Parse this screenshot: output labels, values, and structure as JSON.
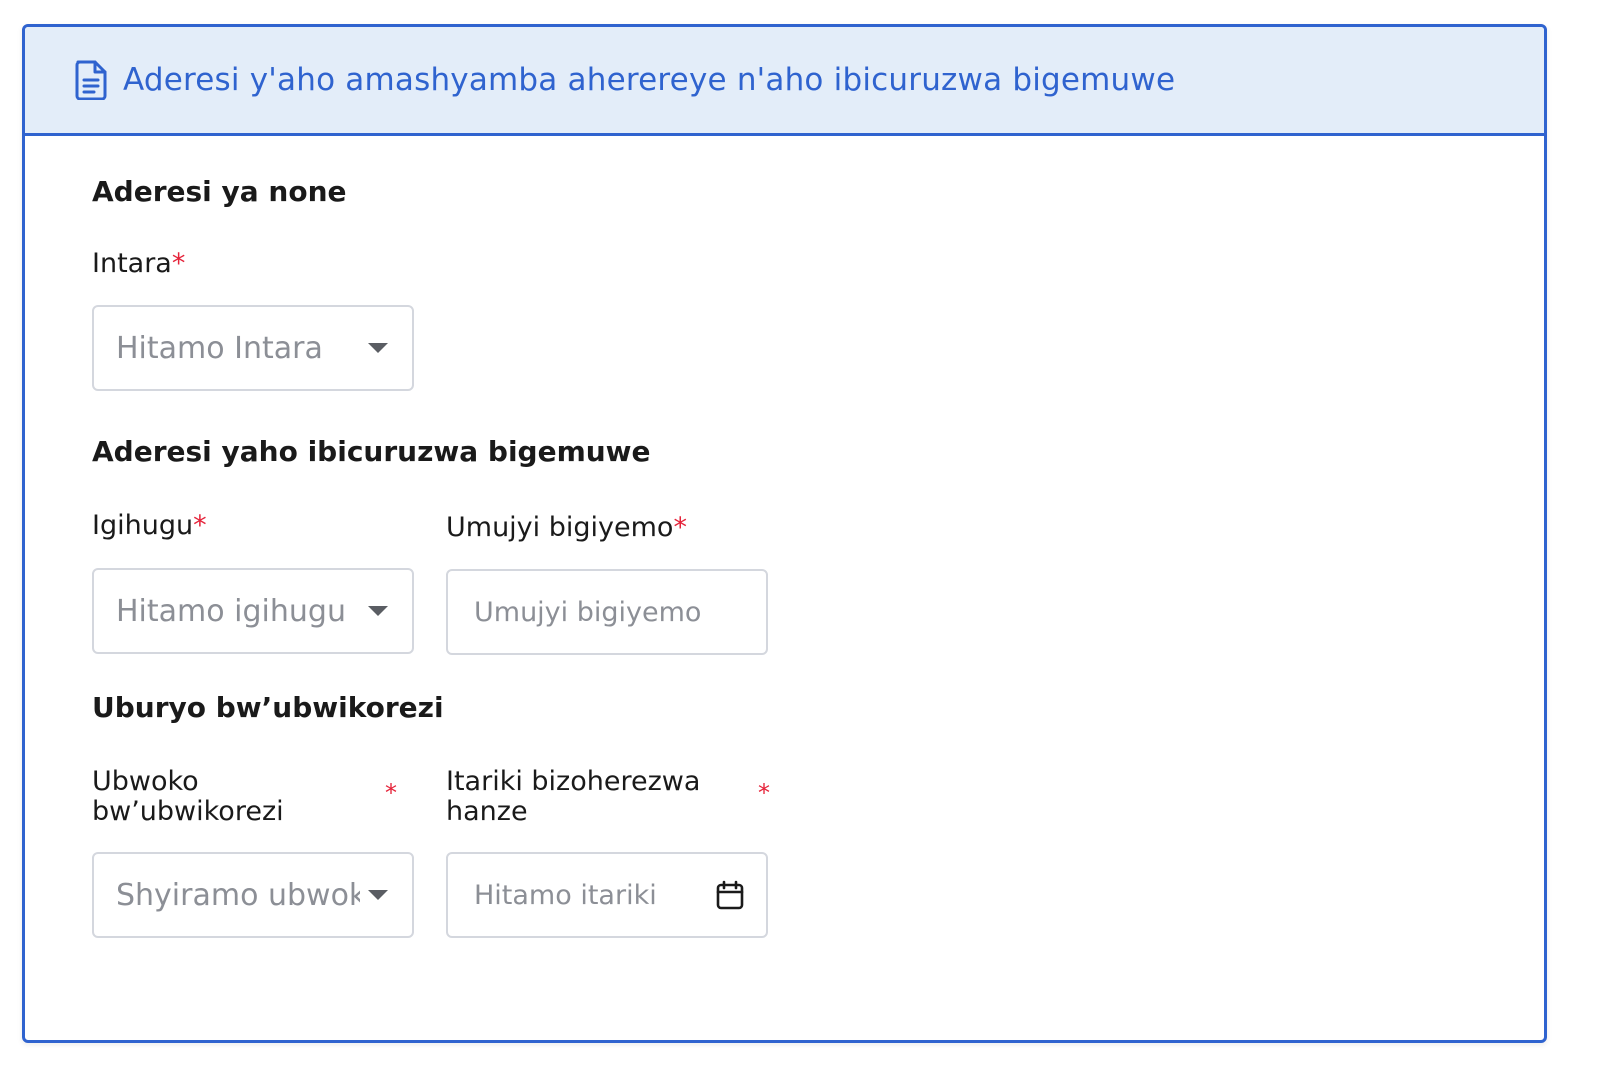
{
  "header": {
    "title": "Aderesi y'aho amashyamba aherereye n'aho ibicuruzwa bigemuwe",
    "icon": "document-icon"
  },
  "sections": {
    "origin": {
      "title": "Aderesi ya none",
      "province": {
        "label": "Intara",
        "required": "*",
        "placeholder": "Hitamo Intara"
      }
    },
    "destination": {
      "title": "Aderesi yaho ibicuruzwa bigemuwe",
      "country": {
        "label": "Igihugu",
        "required": "*",
        "placeholder": "Hitamo igihugu"
      },
      "city": {
        "label": "Umujyi bigiyemo",
        "required": "*",
        "placeholder": "Umujyi bigiyemo"
      }
    },
    "transport": {
      "title": "Uburyo bw’ubwikorezi",
      "mode": {
        "label": "Ubwoko bw’ubwikorezi",
        "required": "*",
        "placeholder": "Shyiramo ubwoko"
      },
      "date": {
        "label": "Itariki bizoherezwa hanze",
        "required": "*",
        "placeholder": "Hitamo itariki",
        "icon": "calendar-icon"
      }
    }
  },
  "colors": {
    "accent": "#2f63cf",
    "header_bg": "#e3edf9",
    "required": "#e5233a",
    "placeholder": "#8c8f96",
    "input_border": "#d4d7de"
  }
}
